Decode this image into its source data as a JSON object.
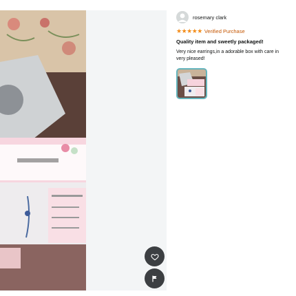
{
  "review": {
    "reviewer_name": "rosemary clark",
    "stars_display": "★★★★★",
    "rating": 5,
    "verified_label": "Verified Purchase",
    "headline": "Quality item and sweetly packaged!",
    "body_lines": [
      "Very nice earrings,in a adorable box with care in",
      "very pleased!"
    ]
  },
  "viewer": {
    "like_icon": "heart-icon",
    "report_icon": "flag-icon"
  },
  "colors": {
    "star": "#f38c18",
    "verified": "#c45500",
    "thumb_border": "#64b5bd",
    "fab": "#3c3f42"
  }
}
